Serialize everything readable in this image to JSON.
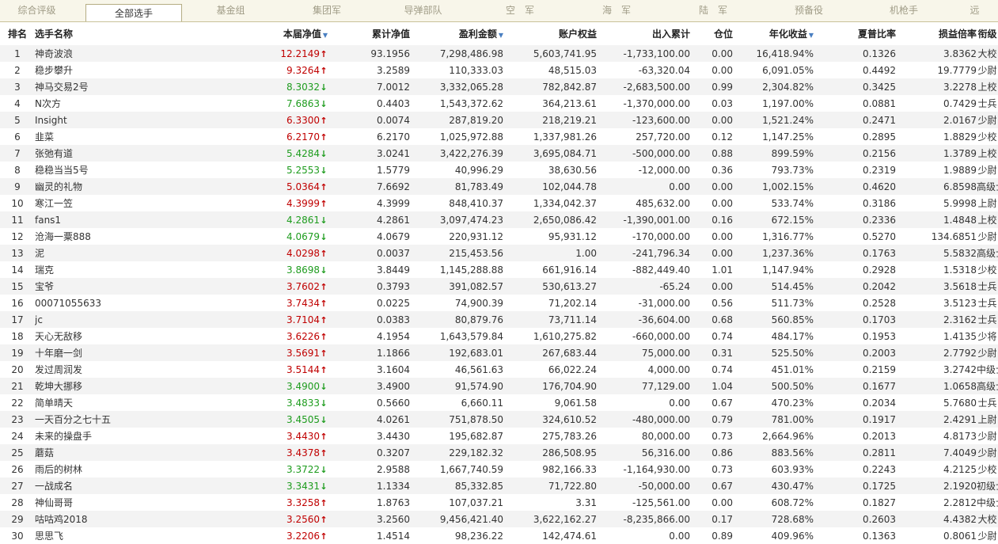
{
  "tabs": [
    "综合评级",
    "全部选手",
    "基金组",
    "集团军",
    "导弹部队",
    "空　军",
    "海　军",
    "陆　军",
    "预备役",
    "机枪手",
    "远"
  ],
  "active_tab": 1,
  "headers": {
    "rank": "排名",
    "name": "选手名称",
    "nav": "本届净值",
    "cum": "累计净值",
    "profit": "盈利金额",
    "equity": "账户权益",
    "flow": "出入累计",
    "pos": "仓位",
    "annual": "年化收益",
    "sharpe": "夏普比率",
    "plr": "损益倍率",
    "title": "衔级"
  },
  "sort_icon": "sort-down-triangle",
  "rows": [
    {
      "rank": "1",
      "name": "神奇波浪",
      "nav": "12.2149",
      "dir": "up",
      "cum": "93.1956",
      "profit": "7,298,486.98",
      "equity": "5,603,741.95",
      "flow": "-1,733,100.00",
      "pos": "0.00",
      "annual": "16,418.94%",
      "sharpe": "0.1326",
      "plr": "3.8362",
      "title": "大校"
    },
    {
      "rank": "2",
      "name": "稳步攀升",
      "nav": "9.3264",
      "dir": "up",
      "cum": "3.2589",
      "profit": "110,333.03",
      "equity": "48,515.03",
      "flow": "-63,320.04",
      "pos": "0.00",
      "annual": "6,091.05%",
      "sharpe": "0.4492",
      "plr": "19.7779",
      "title": "少尉"
    },
    {
      "rank": "3",
      "name": "神马交易2号",
      "nav": "8.3032",
      "dir": "down",
      "cum": "7.0012",
      "profit": "3,332,065.28",
      "equity": "782,842.87",
      "flow": "-2,683,500.00",
      "pos": "0.99",
      "annual": "2,304.82%",
      "sharpe": "0.3425",
      "plr": "3.2278",
      "title": "上校"
    },
    {
      "rank": "4",
      "name": "N次方",
      "nav": "7.6863",
      "dir": "down",
      "cum": "0.4403",
      "profit": "1,543,372.62",
      "equity": "364,213.61",
      "flow": "-1,370,000.00",
      "pos": "0.03",
      "annual": "1,197.00%",
      "sharpe": "0.0881",
      "plr": "0.7429",
      "title": "士兵"
    },
    {
      "rank": "5",
      "name": "Insight",
      "nav": "6.3300",
      "dir": "up",
      "cum": "0.0074",
      "profit": "287,819.20",
      "equity": "218,219.21",
      "flow": "-123,600.00",
      "pos": "0.00",
      "annual": "1,521.24%",
      "sharpe": "0.2471",
      "plr": "2.0167",
      "title": "少尉"
    },
    {
      "rank": "6",
      "name": "韭菜",
      "nav": "6.2170",
      "dir": "up",
      "cum": "6.2170",
      "profit": "1,025,972.88",
      "equity": "1,337,981.26",
      "flow": "257,720.00",
      "pos": "0.12",
      "annual": "1,147.25%",
      "sharpe": "0.2895",
      "plr": "1.8829",
      "title": "少校"
    },
    {
      "rank": "7",
      "name": "张弛有道",
      "nav": "5.4284",
      "dir": "down",
      "cum": "3.0241",
      "profit": "3,422,276.39",
      "equity": "3,695,084.71",
      "flow": "-500,000.00",
      "pos": "0.88",
      "annual": "899.59%",
      "sharpe": "0.2156",
      "plr": "1.3789",
      "title": "上校"
    },
    {
      "rank": "8",
      "name": "稳稳当当5号",
      "nav": "5.2553",
      "dir": "down",
      "cum": "1.5779",
      "profit": "40,996.29",
      "equity": "38,630.56",
      "flow": "-12,000.00",
      "pos": "0.36",
      "annual": "793.73%",
      "sharpe": "0.2319",
      "plr": "1.9889",
      "title": "少尉"
    },
    {
      "rank": "9",
      "name": "幽灵的礼物",
      "nav": "5.0364",
      "dir": "up",
      "cum": "7.6692",
      "profit": "81,783.49",
      "equity": "102,044.78",
      "flow": "0.00",
      "pos": "0.00",
      "annual": "1,002.15%",
      "sharpe": "0.4620",
      "plr": "6.8598",
      "title": "高级士官"
    },
    {
      "rank": "10",
      "name": "寒江一笠",
      "nav": "4.3999",
      "dir": "up",
      "cum": "4.3999",
      "profit": "848,410.37",
      "equity": "1,334,042.37",
      "flow": "485,632.00",
      "pos": "0.00",
      "annual": "533.74%",
      "sharpe": "0.3186",
      "plr": "5.9998",
      "title": "上尉"
    },
    {
      "rank": "11",
      "name": "fans1",
      "nav": "4.2861",
      "dir": "down",
      "cum": "4.2861",
      "profit": "3,097,474.23",
      "equity": "2,650,086.42",
      "flow": "-1,390,001.00",
      "pos": "0.16",
      "annual": "672.15%",
      "sharpe": "0.2336",
      "plr": "1.4848",
      "title": "上校"
    },
    {
      "rank": "12",
      "name": "沧海一粟888",
      "nav": "4.0679",
      "dir": "down",
      "cum": "4.0679",
      "profit": "220,931.12",
      "equity": "95,931.12",
      "flow": "-170,000.00",
      "pos": "0.00",
      "annual": "1,316.77%",
      "sharpe": "0.5270",
      "plr": "134.6851",
      "title": "少尉"
    },
    {
      "rank": "13",
      "name": "泥",
      "nav": "4.0298",
      "dir": "up",
      "cum": "0.0037",
      "profit": "215,453.56",
      "equity": "1.00",
      "flow": "-241,796.34",
      "pos": "0.00",
      "annual": "1,237.36%",
      "sharpe": "0.1763",
      "plr": "5.5832",
      "title": "高级士官"
    },
    {
      "rank": "14",
      "name": "瑞克",
      "nav": "3.8698",
      "dir": "down",
      "cum": "3.8449",
      "profit": "1,145,288.88",
      "equity": "661,916.14",
      "flow": "-882,449.40",
      "pos": "1.01",
      "annual": "1,147.94%",
      "sharpe": "0.2928",
      "plr": "1.5318",
      "title": "少校"
    },
    {
      "rank": "15",
      "name": "宝爷",
      "nav": "3.7602",
      "dir": "up",
      "cum": "0.3793",
      "profit": "391,082.57",
      "equity": "530,613.27",
      "flow": "-65.24",
      "pos": "0.00",
      "annual": "514.45%",
      "sharpe": "0.2042",
      "plr": "3.5618",
      "title": "士兵"
    },
    {
      "rank": "16",
      "name": "00071055633",
      "nav": "3.7434",
      "dir": "up",
      "cum": "0.0225",
      "profit": "74,900.39",
      "equity": "71,202.14",
      "flow": "-31,000.00",
      "pos": "0.56",
      "annual": "511.73%",
      "sharpe": "0.2528",
      "plr": "3.5123",
      "title": "士兵"
    },
    {
      "rank": "17",
      "name": "jc",
      "nav": "3.7104",
      "dir": "up",
      "cum": "0.0383",
      "profit": "80,879.76",
      "equity": "73,711.14",
      "flow": "-36,604.00",
      "pos": "0.68",
      "annual": "560.85%",
      "sharpe": "0.1703",
      "plr": "2.3162",
      "title": "士兵"
    },
    {
      "rank": "18",
      "name": "天心无敌移",
      "nav": "3.6226",
      "dir": "up",
      "cum": "4.1954",
      "profit": "1,643,579.84",
      "equity": "1,610,275.82",
      "flow": "-660,000.00",
      "pos": "0.74",
      "annual": "484.17%",
      "sharpe": "0.1953",
      "plr": "1.4135",
      "title": "少将"
    },
    {
      "rank": "19",
      "name": "十年磨一剑",
      "nav": "3.5691",
      "dir": "up",
      "cum": "1.1866",
      "profit": "192,683.01",
      "equity": "267,683.44",
      "flow": "75,000.00",
      "pos": "0.31",
      "annual": "525.50%",
      "sharpe": "0.2003",
      "plr": "2.7792",
      "title": "少尉"
    },
    {
      "rank": "20",
      "name": "发过周润发",
      "nav": "3.5144",
      "dir": "up",
      "cum": "3.1604",
      "profit": "46,561.63",
      "equity": "66,022.24",
      "flow": "4,000.00",
      "pos": "0.74",
      "annual": "451.01%",
      "sharpe": "0.2159",
      "plr": "3.2742",
      "title": "中级士官"
    },
    {
      "rank": "21",
      "name": "乾坤大挪移",
      "nav": "3.4900",
      "dir": "down",
      "cum": "3.4900",
      "profit": "91,574.90",
      "equity": "176,704.90",
      "flow": "77,129.00",
      "pos": "1.04",
      "annual": "500.50%",
      "sharpe": "0.1677",
      "plr": "1.0658",
      "title": "高级士官"
    },
    {
      "rank": "22",
      "name": "简单晴天",
      "nav": "3.4833",
      "dir": "down",
      "cum": "0.5660",
      "profit": "6,660.11",
      "equity": "9,061.58",
      "flow": "0.00",
      "pos": "0.67",
      "annual": "470.23%",
      "sharpe": "0.2034",
      "plr": "5.7680",
      "title": "士兵"
    },
    {
      "rank": "23",
      "name": "一天百分之七十五",
      "nav": "3.4505",
      "dir": "down",
      "cum": "4.0261",
      "profit": "751,878.50",
      "equity": "324,610.52",
      "flow": "-480,000.00",
      "pos": "0.79",
      "annual": "781.00%",
      "sharpe": "0.1917",
      "plr": "2.4291",
      "title": "上尉"
    },
    {
      "rank": "24",
      "name": "未来的操盘手",
      "nav": "3.4430",
      "dir": "up",
      "cum": "3.4430",
      "profit": "195,682.87",
      "equity": "275,783.26",
      "flow": "80,000.00",
      "pos": "0.73",
      "annual": "2,664.96%",
      "sharpe": "0.2013",
      "plr": "4.8173",
      "title": "少尉"
    },
    {
      "rank": "25",
      "name": "蘑菇",
      "nav": "3.4378",
      "dir": "up",
      "cum": "0.3207",
      "profit": "229,182.32",
      "equity": "286,508.95",
      "flow": "56,316.00",
      "pos": "0.86",
      "annual": "883.56%",
      "sharpe": "0.2811",
      "plr": "7.4049",
      "title": "少尉"
    },
    {
      "rank": "26",
      "name": "雨后的树林",
      "nav": "3.3722",
      "dir": "down",
      "cum": "2.9588",
      "profit": "1,667,740.59",
      "equity": "982,166.33",
      "flow": "-1,164,930.00",
      "pos": "0.73",
      "annual": "603.93%",
      "sharpe": "0.2243",
      "plr": "4.2125",
      "title": "少校"
    },
    {
      "rank": "27",
      "name": "一战成名",
      "nav": "3.3431",
      "dir": "down",
      "cum": "1.1334",
      "profit": "85,332.85",
      "equity": "71,722.80",
      "flow": "-50,000.00",
      "pos": "0.67",
      "annual": "430.47%",
      "sharpe": "0.1725",
      "plr": "2.1920",
      "title": "初级士官"
    },
    {
      "rank": "28",
      "name": "神仙哥哥",
      "nav": "3.3258",
      "dir": "up",
      "cum": "1.8763",
      "profit": "107,037.21",
      "equity": "3.31",
      "flow": "-125,561.00",
      "pos": "0.00",
      "annual": "608.72%",
      "sharpe": "0.1827",
      "plr": "2.2812",
      "title": "中级士官"
    },
    {
      "rank": "29",
      "name": "咕咕鸡2018",
      "nav": "3.2560",
      "dir": "up",
      "cum": "3.2560",
      "profit": "9,456,421.40",
      "equity": "3,622,162.27",
      "flow": "-8,235,866.00",
      "pos": "0.17",
      "annual": "728.68%",
      "sharpe": "0.2603",
      "plr": "4.4382",
      "title": "大校"
    },
    {
      "rank": "30",
      "name": "思思飞",
      "nav": "3.2206",
      "dir": "up",
      "cum": "1.4514",
      "profit": "98,236.22",
      "equity": "142,474.61",
      "flow": "0.00",
      "pos": "0.89",
      "annual": "409.96%",
      "sharpe": "0.1363",
      "plr": "0.8061",
      "title": "少尉"
    }
  ]
}
